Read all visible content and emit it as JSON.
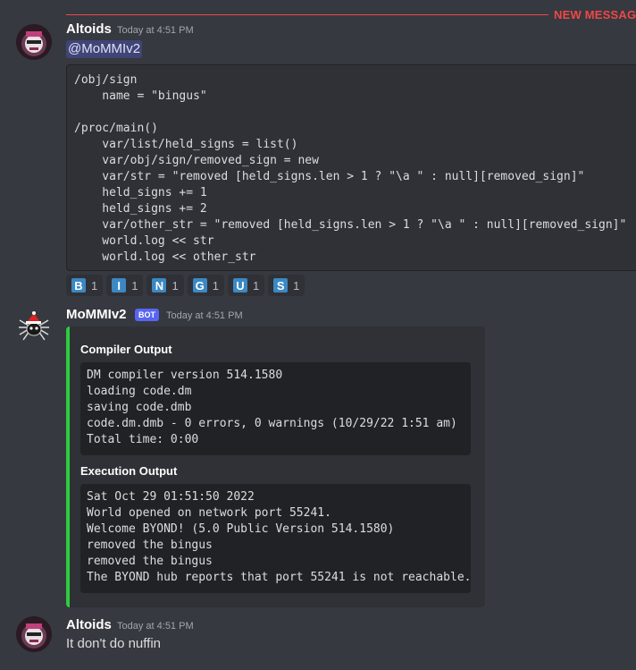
{
  "divider": {
    "label": "NEW MESSAGES"
  },
  "messages": {
    "first": {
      "username": "Altoids",
      "timestamp": "Today at 4:51 PM",
      "mention": "@MoMMIv2",
      "code": "/obj/sign\n    name = \"bingus\"\n\n/proc/main()\n    var/list/held_signs = list()\n    var/obj/sign/removed_sign = new\n    var/str = \"removed [held_signs.len > 1 ? \"\\a \" : null][removed_sign]\"\n    held_signs += 1\n    held_signs += 2\n    var/other_str = \"removed [held_signs.len > 1 ? \"\\a \" : null][removed_sign]\"\n    world.log << str\n    world.log << other_str",
      "reactions": [
        {
          "letter": "B",
          "count": "1"
        },
        {
          "letter": "I",
          "count": "1"
        },
        {
          "letter": "N",
          "count": "1"
        },
        {
          "letter": "G",
          "count": "1"
        },
        {
          "letter": "U",
          "count": "1"
        },
        {
          "letter": "S",
          "count": "1"
        }
      ]
    },
    "bot": {
      "username": "MoMMIv2",
      "bot_tag": "BOT",
      "timestamp": "Today at 4:51 PM",
      "embed": {
        "accent": "#2ecc40",
        "compiler_title": "Compiler Output",
        "compiler_output": "DM compiler version 514.1580\nloading code.dm\nsaving code.dmb\ncode.dm.dmb - 0 errors, 0 warnings (10/29/22 1:51 am)\nTotal time: 0:00",
        "execution_title": "Execution Output",
        "execution_output": "Sat Oct 29 01:51:50 2022\nWorld opened on network port 55241.\nWelcome BYOND! (5.0 Public Version 514.1580)\nremoved the bingus\nremoved the bingus\nThe BYOND hub reports that port 55241 is not reachable."
      }
    },
    "third": {
      "username": "Altoids",
      "timestamp": "Today at 4:51 PM",
      "text": "It don't do nuffin"
    }
  },
  "colors": {
    "background": "#36393f",
    "new_messages": "#f04747",
    "mention_text": "#dee0fc",
    "reaction_badge": "#3b88c3"
  }
}
